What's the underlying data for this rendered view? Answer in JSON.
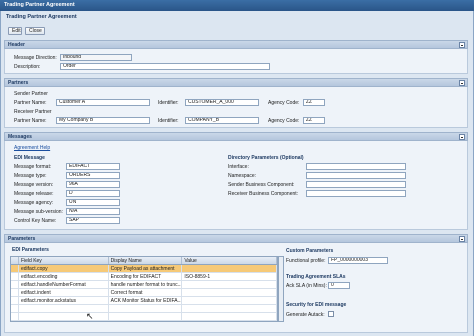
{
  "window": {
    "title": "Trading Partner Agreement"
  },
  "page": {
    "title": "Trading Partner Agreement"
  },
  "toolbar": {
    "edit_label": "Edit",
    "close_label": "Close"
  },
  "header_section": {
    "title": "Header",
    "message_direction_label": "Message Direction:",
    "message_direction_value": "Inbound",
    "description_label": "Description:",
    "description_value": "Order"
  },
  "partners": {
    "title": "Partners",
    "sender_title": "Sender Partner",
    "receiver_title": "Receiver Partner",
    "partner_name_label": "Partner Name:",
    "identifier_label": "Identifier:",
    "agency_code_label": "Agency Code:",
    "sender": {
      "name": "Customer A",
      "identifier": "CUSTOMER_A_000",
      "agency_code": "ZZ"
    },
    "receiver": {
      "name": "My Company B",
      "identifier": "COMPANY_B",
      "agency_code": "ZZ"
    }
  },
  "messages": {
    "title": "Messages",
    "agreement_help": "Agreement Help",
    "edi_title": "EDI Message",
    "fields": [
      {
        "label": "Message format:",
        "value": "EDIFACT"
      },
      {
        "label": "Message type:",
        "value": "ORDERS"
      },
      {
        "label": "Message version:",
        "value": "96A"
      },
      {
        "label": "Message release:",
        "value": "D"
      },
      {
        "label": "Message agency:",
        "value": "UN"
      },
      {
        "label": "Message sub-version:",
        "value": "N/A"
      },
      {
        "label": "Control Key Name:",
        "value": "SAP"
      }
    ],
    "directory_title": "Directory Parameters (Optional)",
    "dir_fields": [
      {
        "label": "Interface:",
        "value": ""
      },
      {
        "label": "Namespace:",
        "value": ""
      },
      {
        "label": "Sender Business Component:",
        "value": ""
      },
      {
        "label": "Receiver Business Component:",
        "value": ""
      }
    ]
  },
  "parameters": {
    "title": "Parameters",
    "edi_title": "EDI Parameters",
    "columns": [
      "Field Key",
      "Display Name",
      "Value"
    ],
    "rows": [
      {
        "key": "edifact.copy",
        "display": "Copy Payload as attachment",
        "value": ""
      },
      {
        "key": "edifact.encoding",
        "display": "Encoding for EDIFACT",
        "value": "ISO-8859-1"
      },
      {
        "key": "edifact.handleNumberFormat",
        "display": "handle number format to trunc...",
        "value": ""
      },
      {
        "key": "edifact.indent",
        "display": "Correct format",
        "value": ""
      },
      {
        "key": "edifact.monitor.ackstatus",
        "display": "ACK Monitor Status for EDIFA...",
        "value": ""
      }
    ],
    "custom_title": "Custom Parameters",
    "functional_profile_label": "Functional profile:",
    "functional_profile_value": "FP_0000000003",
    "sla_title": "Trading Agreement SLAs",
    "ack_sla_label": "Ack SLA (in Mins):",
    "ack_sla_value": "0",
    "security_title": "Security for EDI message",
    "generate_ack_label": "Generate Autack:"
  }
}
